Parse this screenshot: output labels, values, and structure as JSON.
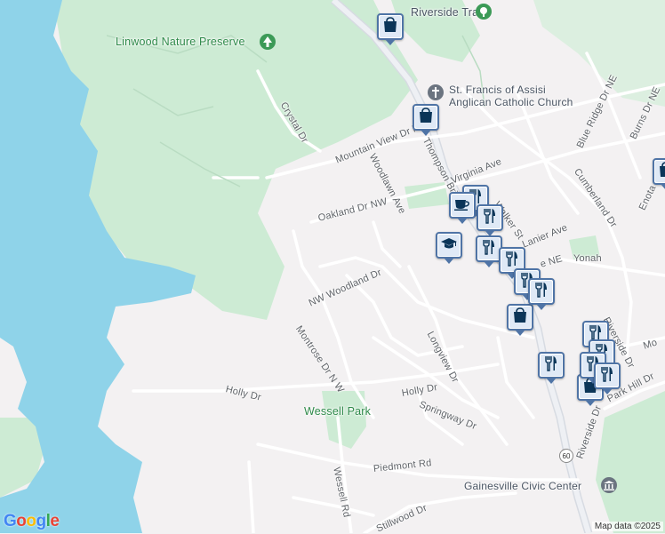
{
  "places": {
    "linwood": "Linwood Nature Preserve",
    "riverside_track": "Riverside Track",
    "church_line1": "St. Francis of Assisi",
    "church_line2": "Anglican Catholic Church",
    "wessell_park": "Wessell Park",
    "civic_center": "Gainesville Civic Center",
    "yonah": "Yonah"
  },
  "streets": {
    "crystal": "Crystal Dr",
    "mountain_view": "Mountain View Dr NW",
    "woodlawn": "Woodlawn Ave",
    "thompson_bridge": "Thompson Bridge",
    "virginia": "Virginia Ave",
    "oakland": "Oakland Dr NW",
    "walker": "Walker St",
    "lanier": "Lanier Ave",
    "blue_ridge": "Blue Ridge Dr NE",
    "burns": "Burns Dr NE",
    "cumberland": "Cumberland Dr",
    "enota": "Enota",
    "nw_woodland": "NW Woodland Dr",
    "montrose": "Montrose Dr N W",
    "longview": "Longview Dr",
    "riverside_dr": "Riverside Dr",
    "riverside_dr2": "Riverside Dr",
    "holly_w": "Holly Dr",
    "holly_e": "Holly Dr",
    "springway": "Springway Dr",
    "park_hill": "Park Hill Dr",
    "piedmont": "Piedmont Rd",
    "wessell_rd": "Wessell Rd",
    "stillwood": "Stillwood Dr",
    "ne_frag": "e NE",
    "mo": "Mo"
  },
  "route_shield": "60",
  "attribution": "Map data ©2025",
  "google_logo": "Google",
  "icons": {
    "shopping": "shopping-bag-icon",
    "restaurant": "fork-knife-icon",
    "cafe": "coffee-cup-icon",
    "school": "graduation-cap-icon",
    "park": "tree-icon",
    "church": "cross-icon",
    "civic": "landmark-icon"
  },
  "colors": {
    "water": "#8fd3e9",
    "park": "#cdebd4",
    "land": "#f3f1f2",
    "road": "#ffffff",
    "highway": "#e2e5ea",
    "pin_border": "#4f74a6",
    "pin_fill": "#dfe9f6",
    "park_label": "#2f8a4a"
  }
}
